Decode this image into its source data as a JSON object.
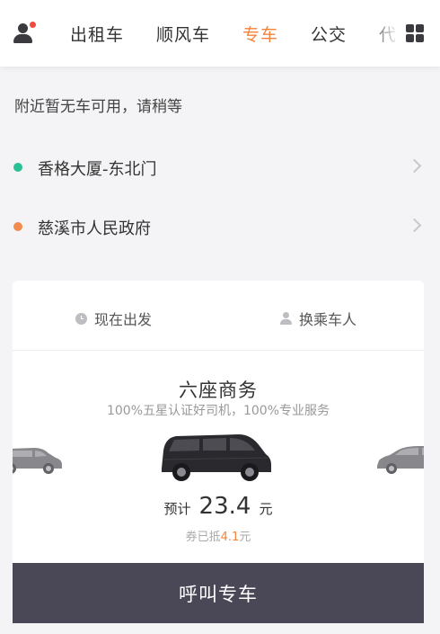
{
  "nav": {
    "tabs": [
      {
        "label": "出租车",
        "active": false
      },
      {
        "label": "顺风车",
        "active": false
      },
      {
        "label": "专车",
        "active": true
      },
      {
        "label": "公交",
        "active": false
      },
      {
        "label": "代驾",
        "active": false
      }
    ],
    "accent_color": "#f7833a"
  },
  "status": "附近暂无车可用，请稍等",
  "locations": {
    "start": {
      "label": "香格大厦-东北门",
      "dot_color": "#2bbf95"
    },
    "end": {
      "label": "慈溪市人民政府",
      "dot_color": "#f28c4e"
    }
  },
  "options": {
    "depart": "现在出发",
    "passenger": "换乘车人"
  },
  "car": {
    "title": "六座商务",
    "subtitle": "100%五星认证好司机，100%专业服务"
  },
  "price": {
    "label": "预计",
    "value": "23.4",
    "unit": "元",
    "coupon_prefix": "券已抵",
    "coupon_amount": "4.1",
    "coupon_unit": "元"
  },
  "call_button": "呼叫专车"
}
